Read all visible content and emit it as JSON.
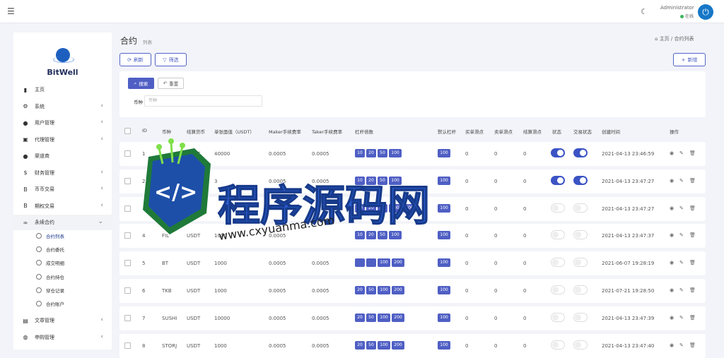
{
  "topbar": {
    "menu_icon": "hamburger-icon",
    "user_name": "Administrator",
    "user_status": "在线",
    "theme_icon": "moon-icon",
    "power_icon": "power-icon"
  },
  "sidebar": {
    "brand": "BitWell",
    "items": [
      {
        "icon": "chart-icon",
        "glyph": "▮",
        "label": "主页",
        "chevron": false
      },
      {
        "icon": "gear-icon",
        "glyph": "⚙",
        "label": "系统",
        "chevron": true
      },
      {
        "icon": "user-icon",
        "glyph": "●",
        "label": "用户管理",
        "chevron": true
      },
      {
        "icon": "id-card-icon",
        "glyph": "▣",
        "label": "代理管理",
        "chevron": true
      },
      {
        "icon": "person-icon",
        "glyph": "●",
        "label": "渠道商",
        "chevron": false
      },
      {
        "icon": "dollar-icon",
        "glyph": "$",
        "label": "财务管理",
        "chevron": true
      },
      {
        "icon": "bitcoin-icon",
        "glyph": "B",
        "label": "币币交易",
        "chevron": true
      },
      {
        "icon": "bitcoin-icon",
        "glyph": "B",
        "label": "期权交易",
        "chevron": true
      },
      {
        "icon": "link-icon",
        "glyph": "∞",
        "label": "永续合约",
        "chevron": true
      }
    ],
    "subitems": [
      "合约列表",
      "合约委托",
      "成交明细",
      "合约持仓",
      "穿仓记录",
      "合约账户"
    ],
    "bottom_items": [
      {
        "icon": "newspaper-icon",
        "glyph": "▤",
        "label": "文章管理"
      },
      {
        "icon": "globe-icon",
        "glyph": "◍",
        "label": "申购管理"
      }
    ]
  },
  "page": {
    "title": "合约",
    "subtitle": "列表",
    "breadcrumb_home": "主页",
    "breadcrumb_sep": "/",
    "breadcrumb_current": "合约列表"
  },
  "toolbar": {
    "refresh": "刷新",
    "filter": "筛选",
    "add": "新增"
  },
  "filter": {
    "search": "搜索",
    "reset": "重置",
    "label": "币种",
    "placeholder": "币种"
  },
  "table": {
    "headers": [
      "ID",
      "币种",
      "结算货币",
      "单张面值（USDT）",
      "Maker手续费率",
      "Taker手续费率",
      "杠杆倍数",
      "默认杠杆",
      "买单滑点",
      "卖单滑点",
      "结算滑点",
      "状态",
      "交易状态",
      "创建时间",
      "操作"
    ],
    "rows": [
      {
        "id": "1",
        "coin": "",
        "settle": "USDT",
        "face": "40000",
        "maker": "0.0005",
        "taker": "0.0005",
        "levers": [
          "10",
          "20",
          "50",
          "100"
        ],
        "default": "100",
        "buy": "0",
        "sell": "0",
        "settle_slip": "0",
        "status": true,
        "trade": true,
        "created": "2021-04-13 23:46:59"
      },
      {
        "id": "2",
        "coin": "",
        "settle": "",
        "face": "3",
        "maker": "0.0005",
        "taker": "0.0005",
        "levers": [
          "10",
          "20",
          "50",
          "100"
        ],
        "default": "100",
        "buy": "0",
        "sell": "0",
        "settle_slip": "0",
        "status": true,
        "trade": true,
        "created": "2021-04-13 23:47:27"
      },
      {
        "id": "",
        "coin": "",
        "settle": "USDT",
        "face": "",
        "maker": "",
        "taker": "",
        "levers": [
          "10",
          "20",
          "50",
          "100",
          "200"
        ],
        "default": "100",
        "buy": "0",
        "sell": "0",
        "settle_slip": "0",
        "status": false,
        "trade": false,
        "created": "2021-04-13 23:47:27"
      },
      {
        "id": "4",
        "coin": "FIL",
        "settle": "USDT",
        "face": "1000",
        "maker": "0.0005",
        "taker": "",
        "levers": [
          "10",
          "20",
          "50",
          "100"
        ],
        "default": "100",
        "buy": "0",
        "sell": "0",
        "settle_slip": "0",
        "status": false,
        "trade": false,
        "created": "2021-04-13 23:47:37"
      },
      {
        "id": "5",
        "coin": "BT",
        "settle": "USDT",
        "face": "1000",
        "maker": "0.0005",
        "taker": "0.0005",
        "levers": [
          "",
          "",
          "100",
          "200"
        ],
        "default": "100",
        "buy": "0",
        "sell": "0",
        "settle_slip": "0",
        "status": false,
        "trade": false,
        "created": "2021-06-07 19:28:19"
      },
      {
        "id": "6",
        "coin": "TKB",
        "settle": "USDT",
        "face": "1000",
        "maker": "0.0005",
        "taker": "0.0005",
        "levers": [
          "20",
          "50",
          "100",
          "200"
        ],
        "default": "100",
        "buy": "0",
        "sell": "0",
        "settle_slip": "0",
        "status": false,
        "trade": false,
        "created": "2021-07-21 19:28:50"
      },
      {
        "id": "7",
        "coin": "SUSHI",
        "settle": "USDT",
        "face": "10000",
        "maker": "0.0005",
        "taker": "0.0005",
        "levers": [
          "20",
          "50",
          "100",
          "200"
        ],
        "default": "100",
        "buy": "0",
        "sell": "0",
        "settle_slip": "0",
        "status": false,
        "trade": false,
        "created": "2021-04-13 23:47:39"
      },
      {
        "id": "8",
        "coin": "STORJ",
        "settle": "USDT",
        "face": "1000",
        "maker": "0.0005",
        "taker": "0.0005",
        "levers": [
          "20",
          "50",
          "100",
          "200"
        ],
        "default": "100",
        "buy": "0",
        "sell": "0",
        "settle_slip": "0",
        "status": false,
        "trade": false,
        "created": "2021-04-13 23:47:40"
      }
    ],
    "actions": [
      "eye-icon",
      "edit-icon",
      "trash-icon"
    ]
  },
  "watermark": {
    "title": "程序源码网",
    "url": "www.cxyuanma.com",
    "logo_text": "</>"
  },
  "colors": {
    "accent": "#4f5fc4",
    "power": "#1677c7",
    "online": "#3bb75e"
  }
}
